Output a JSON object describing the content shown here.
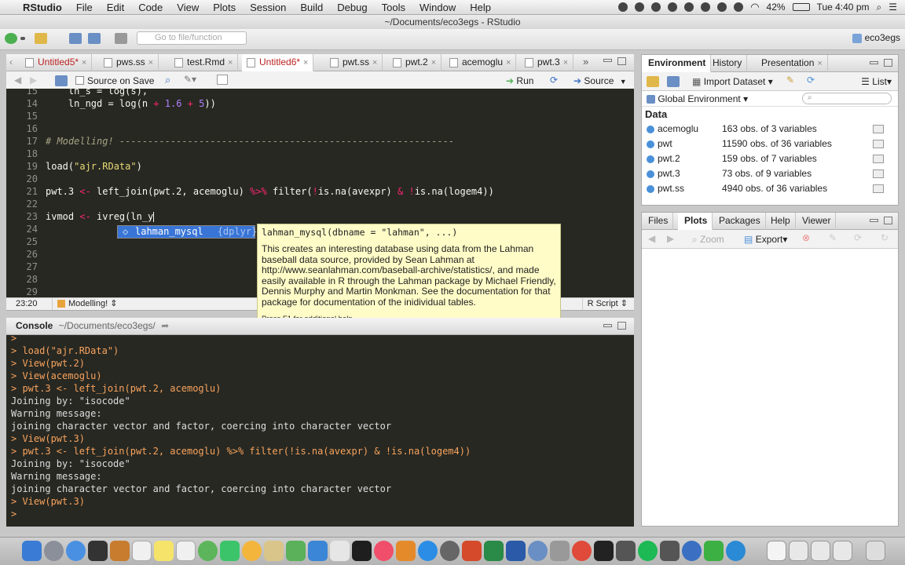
{
  "menubar": {
    "apple": "",
    "app_name": "RStudio",
    "items": [
      "File",
      "Edit",
      "Code",
      "View",
      "Plots",
      "Session",
      "Build",
      "Debug",
      "Tools",
      "Window",
      "Help"
    ],
    "battery": "42%",
    "clock": "Tue 4:40 pm"
  },
  "window_title": "~/Documents/eco3egs - RStudio",
  "toolbar": {
    "goto_placeholder": "Go to file/function",
    "project": "eco3egs"
  },
  "editor_tabs": [
    {
      "label": "Untitled5*",
      "active": false
    },
    {
      "label": "pws.ss",
      "active": false
    },
    {
      "label": "test.Rmd",
      "active": false
    },
    {
      "label": "Untitled6*",
      "active": true
    },
    {
      "label": "pwt.ss",
      "active": false
    },
    {
      "label": "pwt.2",
      "active": false
    },
    {
      "label": "acemoglu",
      "active": false
    },
    {
      "label": "pwt.3",
      "active": false
    }
  ],
  "editor_toolbar": {
    "source_on_save": "Source on Save",
    "run": "Run",
    "source": "Source"
  },
  "editor": {
    "line_numbers": [
      "15",
      "14",
      "15",
      "16",
      "17",
      "18",
      "19",
      "20",
      "21",
      "22",
      "23",
      "24",
      "25",
      "26",
      "27",
      "28",
      "29"
    ],
    "lines": {
      "l13": "    ln_s = log(s),",
      "l14a": "    ln_ngd = log(n ",
      "l14b": "+",
      "l14c": " ",
      "l14d": "1.6",
      "l14e": " + ",
      "l14f": "5",
      "l14g": "))",
      "l17": "# Modelling! -----------------------------------------------------------",
      "l19a": "load(",
      "l19b": "\"ajr.RData\"",
      "l19c": ")",
      "l21a": "pwt.3 ",
      "l21b": "<-",
      "l21c": " left_join(pwt.2, acemoglu) ",
      "l21d": "%>%",
      "l21e": " filter(",
      "l21f": "!",
      "l21g": "is.na(avexpr) ",
      "l21h": "&",
      "l21i": " ",
      "l21j": "!",
      "l21k": "is.na(logem4))",
      "l23a": "ivmod ",
      "l23b": "<-",
      "l23c": " ivreg(ln_y"
    }
  },
  "autocomplete": {
    "item": "lahman_mysql",
    "package": "{dplyr}"
  },
  "tooltip": {
    "signature": "lahman_mysql(dbname = \"lahman\", ...)",
    "description_lines": [
      "This creates an interesting database using data from the Lahman",
      "baseball data source, provided by Sean Lahman at",
      "http://www.seanlahman.com/baseball-archive/statistics/, and made",
      "easily available in R through the Lahman package by Michael Friendly,",
      "Dennis Murphy and Martin Monkman. See the documentation for that",
      "package for documentation of the inidividual tables."
    ],
    "help": "Press F1 for additional help"
  },
  "status": {
    "position": "23:20",
    "section": "Modelling!",
    "filetype": "R Script"
  },
  "console": {
    "title": "Console",
    "path": "~/Documents/eco3egs/",
    "lines": [
      {
        "type": "in",
        "text": ">"
      },
      {
        "type": "in",
        "text": "> load(\"ajr.RData\")"
      },
      {
        "type": "in",
        "text": "> View(pwt.2)"
      },
      {
        "type": "in",
        "text": "> View(acemoglu)"
      },
      {
        "type": "in",
        "text": "> pwt.3 <- left_join(pwt.2, acemoglu)"
      },
      {
        "type": "out",
        "text": "Joining by: \"isocode\""
      },
      {
        "type": "out",
        "text": "Warning message:"
      },
      {
        "type": "out",
        "text": "joining character vector and factor, coercing into character vector"
      },
      {
        "type": "in",
        "text": "> View(pwt.3)"
      },
      {
        "type": "in",
        "text": "> pwt.3 <- left_join(pwt.2, acemoglu) %>% filter(!is.na(avexpr) & !is.na(logem4))"
      },
      {
        "type": "out",
        "text": "Joining by: \"isocode\""
      },
      {
        "type": "out",
        "text": "Warning message:"
      },
      {
        "type": "out",
        "text": "joining character vector and factor, coercing into character vector"
      },
      {
        "type": "in",
        "text": "> View(pwt.3)"
      },
      {
        "type": "in",
        "text": ">"
      }
    ]
  },
  "env_pane": {
    "tabs": [
      "Environment",
      "History",
      "Presentation"
    ],
    "import_dataset": "Import Dataset",
    "list_view": "List",
    "global_env": "Global Environment",
    "section": "Data",
    "rows": [
      {
        "name": "acemoglu",
        "value": "163 obs. of 3 variables"
      },
      {
        "name": "pwt",
        "value": "11590 obs. of 36 variables"
      },
      {
        "name": "pwt.2",
        "value": "159 obs. of 7 variables"
      },
      {
        "name": "pwt.3",
        "value": "73 obs. of 9 variables"
      },
      {
        "name": "pwt.ss",
        "value": "4940 obs. of 36 variables"
      }
    ]
  },
  "files_pane": {
    "tabs": [
      "Files",
      "Plots",
      "Packages",
      "Help",
      "Viewer"
    ],
    "zoom": "Zoom",
    "export": "Export"
  },
  "colors": {
    "editor_bg": "#272822",
    "accent_blue": "#3875d7",
    "tooltip_bg": "#fffcc7"
  }
}
